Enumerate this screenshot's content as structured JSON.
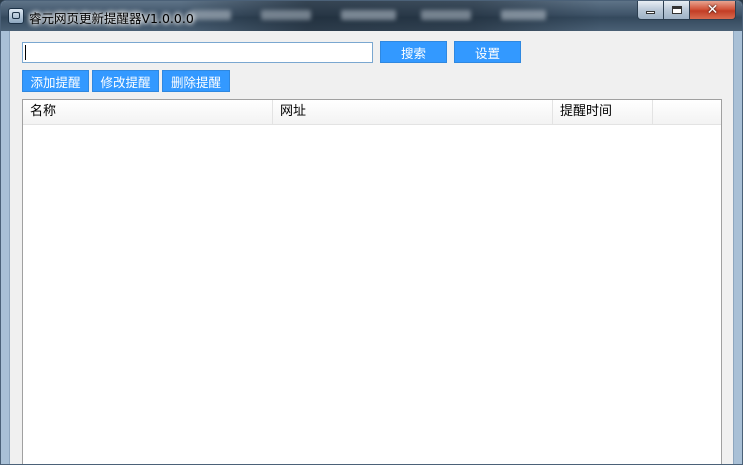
{
  "window": {
    "title": "睿元网页更新提醒器V1.0.0.0",
    "icon": "app-icon",
    "controls": {
      "minimize": "minimize-icon",
      "maximize": "maximize-icon",
      "close": "close-icon"
    }
  },
  "toolbar": {
    "search_value": "",
    "search_label": "搜索",
    "settings_label": "设置",
    "add_label": "添加提醒",
    "edit_label": "修改提醒",
    "delete_label": "删除提醒"
  },
  "table": {
    "columns": [
      "名称",
      "网址",
      "提醒时间"
    ],
    "rows": []
  },
  "colors": {
    "button_blue": "#3399ff",
    "window_background": "#f0f0f0",
    "titlebar": "#3f5469"
  }
}
